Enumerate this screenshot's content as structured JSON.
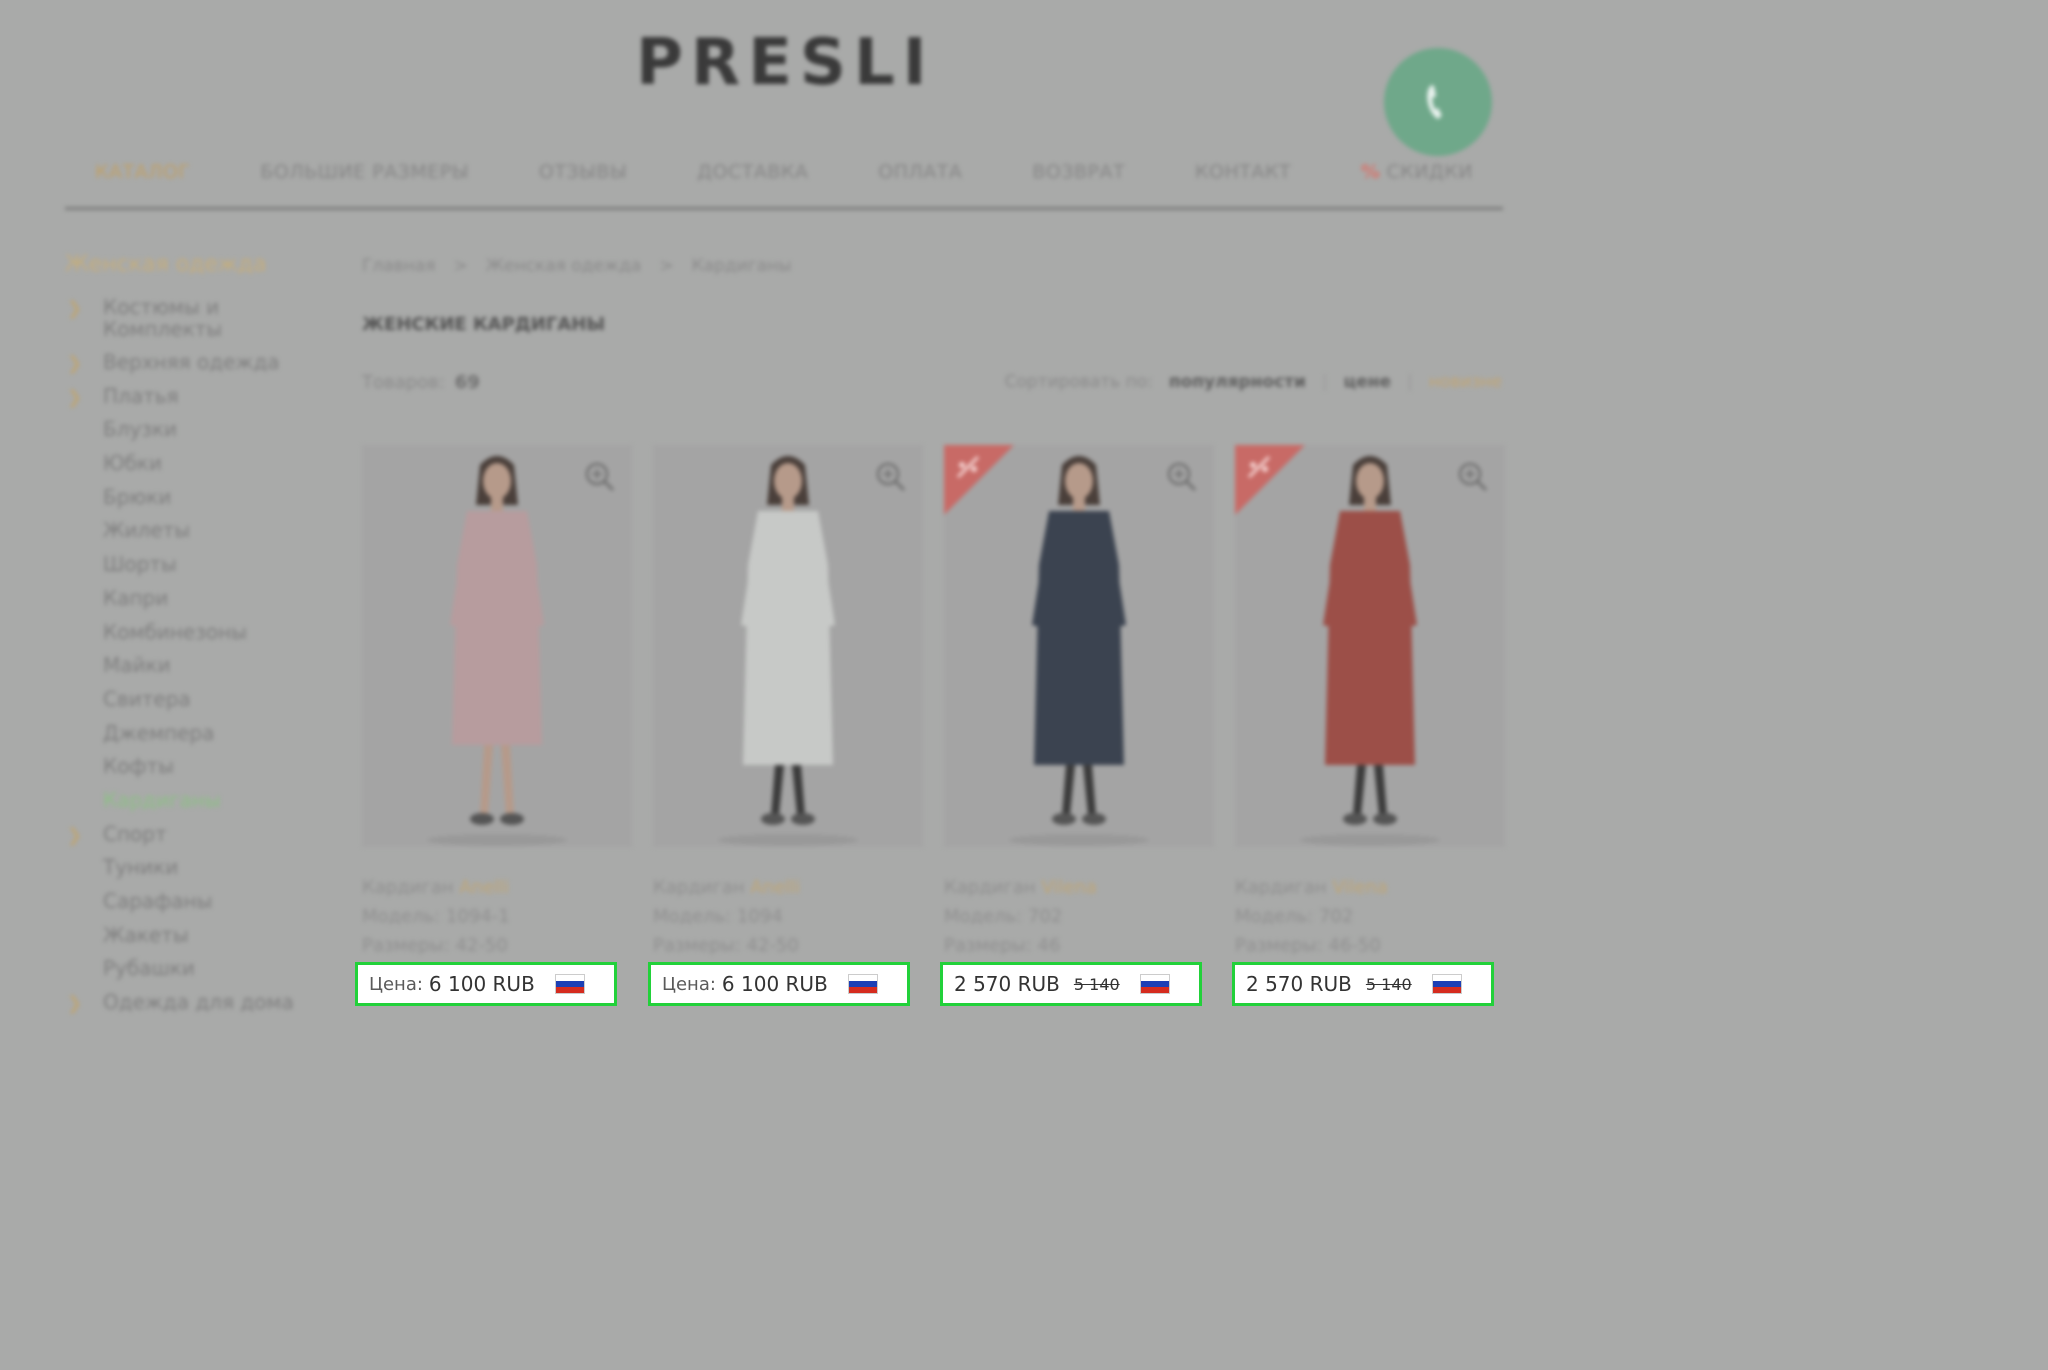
{
  "header": {
    "logo": "PRESLI"
  },
  "nav": {
    "items": [
      {
        "label": "КАТАЛОГ"
      },
      {
        "label": "БОЛЬШИЕ РАЗМЕРЫ"
      },
      {
        "label": "ОТЗЫВЫ"
      },
      {
        "label": "ДОСТАВКА"
      },
      {
        "label": "ОПЛАТА"
      },
      {
        "label": "ВОЗВРАТ"
      },
      {
        "label": "КОНТАКТ"
      },
      {
        "label": "СКИДКИ",
        "prefix": "%"
      }
    ]
  },
  "sidebar": {
    "title": "Женская одежда",
    "items": [
      {
        "label": "Костюмы и Комплекты",
        "expandable": true
      },
      {
        "label": "Верхняя одежда",
        "expandable": true
      },
      {
        "label": "Платья",
        "expandable": true
      },
      {
        "label": "Блузки",
        "expandable": false
      },
      {
        "label": "Юбки",
        "expandable": false
      },
      {
        "label": "Брюки",
        "expandable": false
      },
      {
        "label": "Жилеты",
        "expandable": false
      },
      {
        "label": "Шорты",
        "expandable": false
      },
      {
        "label": "Капри",
        "expandable": false
      },
      {
        "label": "Комбинезоны",
        "expandable": false
      },
      {
        "label": "Майки",
        "expandable": false
      },
      {
        "label": "Свитера",
        "expandable": false
      },
      {
        "label": "Джемпера",
        "expandable": false
      },
      {
        "label": "Кофты",
        "expandable": false
      },
      {
        "label": "Кардиганы",
        "expandable": false,
        "active": true
      },
      {
        "label": "Спорт",
        "expandable": true
      },
      {
        "label": "Туники",
        "expandable": false
      },
      {
        "label": "Сарафаны",
        "expandable": false
      },
      {
        "label": "Жакеты",
        "expandable": false
      },
      {
        "label": "Рубашки",
        "expandable": false
      },
      {
        "label": "Одежда для дома",
        "expandable": true
      }
    ]
  },
  "breadcrumb": {
    "items": [
      "Главная",
      "Женская одежда",
      "Кардиганы"
    ],
    "separator": ">"
  },
  "page": {
    "title": "ЖЕНСКИЕ КАРДИГАНЫ",
    "count_label": "Товаров:",
    "count_value": "69"
  },
  "sort": {
    "label": "Сортировать по:",
    "options": [
      "популярности",
      "цене",
      "новизне"
    ],
    "separator": "|"
  },
  "products": [
    {
      "type": "Кардиган",
      "brand": "Anelli",
      "model": "Модель: 1094-1",
      "sizes": "Размеры: 42-50",
      "price_label": "Цена:",
      "price": "6 100 RUB",
      "old_price": "",
      "sale": false,
      "coat_color": "#b79c9e",
      "skirt": true
    },
    {
      "type": "Кардиган",
      "brand": "Anelli",
      "model": "Модель: 1094",
      "sizes": "Размеры: 42-50",
      "price_label": "Цена:",
      "price": "6 100 RUB",
      "old_price": "",
      "sale": false,
      "coat_color": "#c7c9c7",
      "skirt": false
    },
    {
      "type": "Кардиган",
      "brand": "Vilena",
      "model": "Модель: 702",
      "sizes": "Размеры: 46",
      "price_label": "",
      "price": "2 570 RUB",
      "old_price": "5 140",
      "sale": true,
      "coat_color": "#3b4350",
      "skirt": false
    },
    {
      "type": "Кардиган",
      "brand": "Vilena",
      "model": "Модель: 702",
      "sizes": "Размеры: 46-50",
      "price_label": "",
      "price": "2 570 RUB",
      "old_price": "5 140",
      "sale": true,
      "coat_color": "#9c4f48",
      "skirt": false
    }
  ],
  "colors": {
    "accent_gold": "#c0a066",
    "active_green": "#8dbf86",
    "highlight_border": "#22d13a",
    "phone_button": "#6fa88a",
    "sale_ribbon": "#c86a66"
  },
  "icons": {
    "phone": "phone-icon",
    "zoom": "magnify-plus-icon",
    "sale": "sale-ribbon-icon",
    "flag": "russian-flag-icon"
  }
}
